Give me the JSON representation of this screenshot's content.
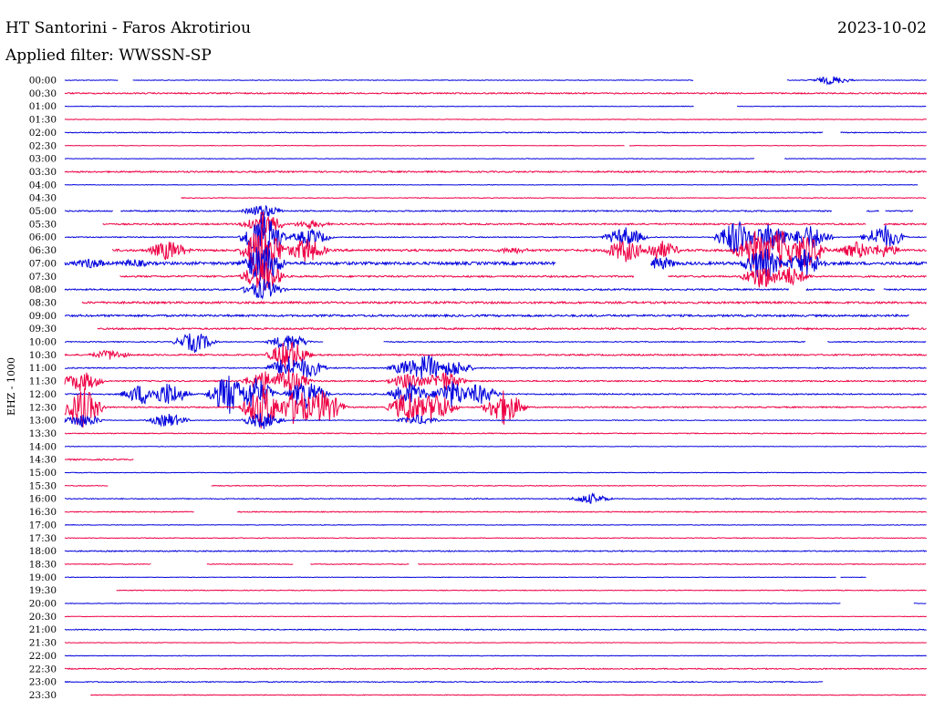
{
  "header": {
    "station": "HT Santorini - Faros Akrotiriou",
    "filter": "Applied filter: WWSSN-SP",
    "date": "2023-10-02"
  },
  "colors": {
    "blue_trace": "#0000dd",
    "red_trace": "#ee0044",
    "text": "#000000",
    "background": "#ffffff"
  },
  "chart_data": {
    "type": "line",
    "subtype": "helicorder",
    "title": "HT Santorini - Faros Akrotiriou",
    "subtitle": "Applied filter: WWSSN-SP",
    "date": "2023-10-02",
    "ylabel": "EHZ - 1000",
    "xlabel": "",
    "row_duration_minutes": 30,
    "x_units": "fraction of 30-minute row",
    "grid": false,
    "legend": "none",
    "rows": [
      {
        "time": "00:00",
        "color": "blue",
        "noise": 0.3,
        "segments": [
          [
            0,
            0.062
          ],
          [
            0.079,
            0.73
          ],
          [
            0.838,
            1
          ]
        ],
        "bursts": [
          [
            0.89,
            5
          ]
        ]
      },
      {
        "time": "00:30",
        "color": "red",
        "noise": 0.7,
        "segments": [
          [
            0,
            1
          ]
        ],
        "bursts": []
      },
      {
        "time": "01:00",
        "color": "blue",
        "noise": 0.3,
        "segments": [
          [
            0,
            0.73
          ],
          [
            0.78,
            1
          ]
        ],
        "bursts": []
      },
      {
        "time": "01:30",
        "color": "red",
        "noise": 0.3,
        "segments": [
          [
            0,
            1
          ]
        ],
        "bursts": []
      },
      {
        "time": "02:00",
        "color": "blue",
        "noise": 0.5,
        "segments": [
          [
            0,
            0.88
          ],
          [
            0.9,
            1
          ]
        ],
        "bursts": []
      },
      {
        "time": "02:30",
        "color": "red",
        "noise": 0.3,
        "segments": [
          [
            0,
            0.65
          ],
          [
            0.655,
            1
          ]
        ],
        "bursts": []
      },
      {
        "time": "03:00",
        "color": "blue",
        "noise": 0.3,
        "segments": [
          [
            0,
            0.8
          ],
          [
            0.835,
            1
          ]
        ],
        "bursts": []
      },
      {
        "time": "03:30",
        "color": "red",
        "noise": 0.8,
        "segments": [
          [
            0,
            1
          ]
        ],
        "bursts": []
      },
      {
        "time": "04:00",
        "color": "blue",
        "noise": 0.3,
        "segments": [
          [
            0,
            0.99
          ]
        ],
        "bursts": []
      },
      {
        "time": "04:30",
        "color": "red",
        "noise": 0.4,
        "segments": [
          [
            0.135,
            1
          ]
        ],
        "bursts": []
      },
      {
        "time": "05:00",
        "color": "blue",
        "noise": 0.7,
        "segments": [
          [
            0,
            0.056
          ],
          [
            0.065,
            0.89
          ],
          [
            0.93,
            0.945
          ],
          [
            0.952,
            0.985
          ]
        ],
        "bursts": [
          [
            0.23,
            8
          ]
        ]
      },
      {
        "time": "05:30",
        "color": "red",
        "noise": 0.8,
        "segments": [
          [
            0.044,
            0.93
          ],
          [
            0.95,
            1
          ]
        ],
        "bursts": [
          [
            0.23,
            15
          ],
          [
            0.285,
            5
          ]
        ]
      },
      {
        "time": "06:00",
        "color": "blue",
        "noise": 0.5,
        "segments": [
          [
            0,
            1
          ]
        ],
        "bursts": [
          [
            0.23,
            30
          ],
          [
            0.285,
            10
          ],
          [
            0.65,
            12
          ],
          [
            0.78,
            22
          ],
          [
            0.82,
            18
          ],
          [
            0.865,
            15
          ],
          [
            0.95,
            15
          ]
        ]
      },
      {
        "time": "06:30",
        "color": "red",
        "noise": 1.2,
        "segments": [
          [
            0.055,
            1
          ]
        ],
        "bursts": [
          [
            0.12,
            12
          ],
          [
            0.23,
            35
          ],
          [
            0.28,
            15
          ],
          [
            0.52,
            4
          ],
          [
            0.65,
            14
          ],
          [
            0.69,
            12
          ],
          [
            0.8,
            22
          ],
          [
            0.83,
            25
          ],
          [
            0.86,
            20
          ],
          [
            0.92,
            10
          ],
          [
            0.95,
            8
          ]
        ]
      },
      {
        "time": "07:00",
        "color": "blue",
        "noise": 1.6,
        "segments": [
          [
            0,
            0.12
          ],
          [
            0.12,
            0.57
          ],
          [
            0.68,
            1
          ]
        ],
        "bursts": [
          [
            0.03,
            6
          ],
          [
            0.08,
            5
          ],
          [
            0.23,
            25
          ],
          [
            0.69,
            8
          ],
          [
            0.81,
            20
          ],
          [
            0.86,
            16
          ]
        ]
      },
      {
        "time": "07:30",
        "color": "red",
        "noise": 0.9,
        "segments": [
          [
            0.064,
            0.66
          ],
          [
            0.7,
            1
          ]
        ],
        "bursts": [
          [
            0.23,
            20
          ],
          [
            0.81,
            15
          ],
          [
            0.84,
            12
          ]
        ]
      },
      {
        "time": "08:00",
        "color": "blue",
        "noise": 0.8,
        "segments": [
          [
            0,
            0.84
          ],
          [
            0.86,
            0.94
          ],
          [
            0.95,
            1
          ]
        ],
        "bursts": [
          [
            0.23,
            12
          ]
        ]
      },
      {
        "time": "08:30",
        "color": "red",
        "noise": 1.1,
        "segments": [
          [
            0.02,
            1
          ]
        ],
        "bursts": []
      },
      {
        "time": "09:00",
        "color": "blue",
        "noise": 1.1,
        "segments": [
          [
            0,
            0.98
          ]
        ],
        "bursts": []
      },
      {
        "time": "09:30",
        "color": "red",
        "noise": 0.9,
        "segments": [
          [
            0.038,
            1
          ]
        ],
        "bursts": []
      },
      {
        "time": "10:00",
        "color": "blue",
        "noise": 0.5,
        "segments": [
          [
            0,
            0.3
          ],
          [
            0.37,
            0.86
          ],
          [
            0.885,
            1
          ]
        ],
        "bursts": [
          [
            0.151,
            12
          ],
          [
            0.26,
            10
          ]
        ]
      },
      {
        "time": "10:30",
        "color": "red",
        "noise": 0.8,
        "segments": [
          [
            0,
            1
          ]
        ],
        "bursts": [
          [
            0.052,
            6
          ],
          [
            0.26,
            18
          ]
        ]
      },
      {
        "time": "11:00",
        "color": "blue",
        "noise": 0.6,
        "segments": [
          [
            0,
            1
          ]
        ],
        "bursts": [
          [
            0.26,
            14
          ],
          [
            0.28,
            12
          ],
          [
            0.4,
            10
          ],
          [
            0.42,
            16
          ],
          [
            0.45,
            10
          ]
        ]
      },
      {
        "time": "11:30",
        "color": "red",
        "noise": 0.7,
        "segments": [
          [
            0,
            1
          ]
        ],
        "bursts": [
          [
            0.02,
            12
          ],
          [
            0.23,
            12
          ],
          [
            0.26,
            16
          ],
          [
            0.4,
            10
          ],
          [
            0.44,
            12
          ]
        ]
      },
      {
        "time": "12:00",
        "color": "blue",
        "noise": 0.7,
        "segments": [
          [
            0,
            1
          ]
        ],
        "bursts": [
          [
            0.09,
            12
          ],
          [
            0.12,
            14
          ],
          [
            0.19,
            24
          ],
          [
            0.22,
            20
          ],
          [
            0.28,
            18
          ],
          [
            0.4,
            14
          ],
          [
            0.45,
            16
          ],
          [
            0.48,
            12
          ]
        ]
      },
      {
        "time": "12:30",
        "color": "red",
        "noise": 0.7,
        "segments": [
          [
            0,
            1
          ]
        ],
        "bursts": [
          [
            0.02,
            24
          ],
          [
            0.23,
            26
          ],
          [
            0.27,
            22
          ],
          [
            0.3,
            20
          ],
          [
            0.4,
            20
          ],
          [
            0.43,
            18
          ],
          [
            0.51,
            20
          ]
        ]
      },
      {
        "time": "13:00",
        "color": "blue",
        "noise": 0.4,
        "segments": [
          [
            0,
            1
          ]
        ],
        "bursts": [
          [
            0.02,
            8
          ],
          [
            0.12,
            8
          ],
          [
            0.23,
            10
          ],
          [
            0.41,
            6
          ]
        ]
      },
      {
        "time": "13:30",
        "color": "red",
        "noise": 0.5,
        "segments": [
          [
            0,
            1
          ]
        ],
        "bursts": []
      },
      {
        "time": "14:00",
        "color": "blue",
        "noise": 0.3,
        "segments": [
          [
            0,
            1
          ]
        ],
        "bursts": []
      },
      {
        "time": "14:30",
        "color": "red",
        "noise": 0.7,
        "segments": [
          [
            0,
            0.08
          ]
        ],
        "bursts": []
      },
      {
        "time": "15:00",
        "color": "blue",
        "noise": 0.3,
        "segments": [
          [
            0,
            1
          ]
        ],
        "bursts": []
      },
      {
        "time": "15:30",
        "color": "red",
        "noise": 0.4,
        "segments": [
          [
            0,
            0.05
          ],
          [
            0.17,
            1
          ]
        ],
        "bursts": []
      },
      {
        "time": "16:00",
        "color": "blue",
        "noise": 0.5,
        "segments": [
          [
            0,
            1
          ]
        ],
        "bursts": [
          [
            0.61,
            6
          ]
        ]
      },
      {
        "time": "16:30",
        "color": "red",
        "noise": 0.5,
        "segments": [
          [
            0,
            0.15
          ],
          [
            0.2,
            1
          ]
        ],
        "bursts": []
      },
      {
        "time": "17:00",
        "color": "blue",
        "noise": 0.3,
        "segments": [
          [
            0,
            1
          ]
        ],
        "bursts": []
      },
      {
        "time": "17:30",
        "color": "red",
        "noise": 0.4,
        "segments": [
          [
            0,
            1
          ]
        ],
        "bursts": []
      },
      {
        "time": "18:00",
        "color": "blue",
        "noise": 0.6,
        "segments": [
          [
            0,
            1
          ]
        ],
        "bursts": []
      },
      {
        "time": "18:30",
        "color": "red",
        "noise": 0.4,
        "segments": [
          [
            0,
            0.1
          ],
          [
            0.165,
            0.265
          ],
          [
            0.285,
            0.4
          ],
          [
            0.41,
            1
          ]
        ],
        "bursts": []
      },
      {
        "time": "19:00",
        "color": "blue",
        "noise": 0.3,
        "segments": [
          [
            0,
            0.895
          ],
          [
            0.9,
            0.93
          ]
        ],
        "bursts": []
      },
      {
        "time": "19:30",
        "color": "red",
        "noise": 0.4,
        "segments": [
          [
            0.06,
            1
          ]
        ],
        "bursts": []
      },
      {
        "time": "20:00",
        "color": "blue",
        "noise": 0.3,
        "segments": [
          [
            0,
            0.9
          ],
          [
            0.985,
            1
          ]
        ],
        "bursts": []
      },
      {
        "time": "20:30",
        "color": "red",
        "noise": 0.3,
        "segments": [
          [
            0,
            1
          ]
        ],
        "bursts": []
      },
      {
        "time": "21:00",
        "color": "blue",
        "noise": 0.5,
        "segments": [
          [
            0,
            1
          ]
        ],
        "bursts": []
      },
      {
        "time": "21:30",
        "color": "red",
        "noise": 0.3,
        "segments": [
          [
            0,
            1
          ]
        ],
        "bursts": []
      },
      {
        "time": "22:00",
        "color": "blue",
        "noise": 0.3,
        "segments": [
          [
            0,
            1
          ]
        ],
        "bursts": []
      },
      {
        "time": "22:30",
        "color": "red",
        "noise": 0.6,
        "segments": [
          [
            0,
            1
          ]
        ],
        "bursts": []
      },
      {
        "time": "23:00",
        "color": "blue",
        "noise": 0.5,
        "segments": [
          [
            0,
            0.88
          ]
        ],
        "bursts": []
      },
      {
        "time": "23:30",
        "color": "red",
        "noise": 0.4,
        "segments": [
          [
            0.03,
            1
          ]
        ],
        "bursts": []
      }
    ]
  }
}
